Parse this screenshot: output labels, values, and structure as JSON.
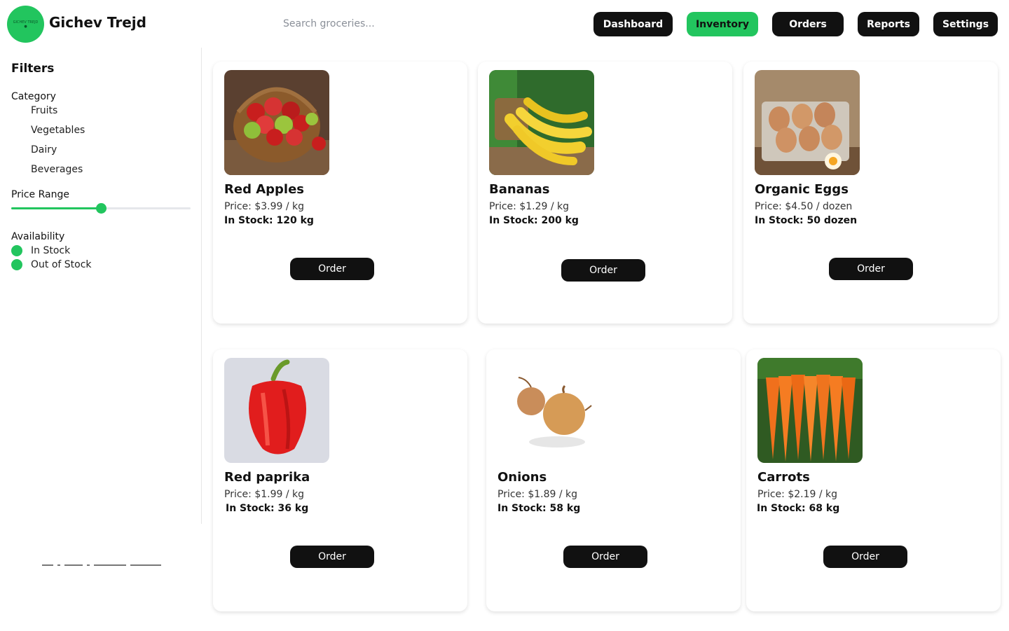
{
  "header": {
    "logo_text": "GICHEV TREJD",
    "brand": "Gichev Trejd",
    "search_placeholder": "Search groceries...",
    "nav": [
      {
        "label": "Dashboard",
        "active": false
      },
      {
        "label": "Inventory",
        "active": true
      },
      {
        "label": "Orders",
        "active": false
      },
      {
        "label": "Reports",
        "active": false
      },
      {
        "label": "Settings",
        "active": false
      }
    ]
  },
  "sidebar": {
    "title": "Filters",
    "category_title": "Category",
    "categories": [
      "Fruits",
      "Vegetables",
      "Dairy",
      "Beverages"
    ],
    "price_title": "Price Range",
    "price_level": 0.5,
    "availability_title": "Availability",
    "availability": [
      "In Stock",
      "Out of Stock"
    ]
  },
  "products": [
    {
      "name": "Red Apples",
      "price": "Price: $3.99 / kg",
      "stock": "In Stock: 120 kg",
      "order_label": "Order",
      "image": "apples-basket"
    },
    {
      "name": "Bananas",
      "price": "Price: $1.29 / kg",
      "stock": "In Stock: 200 kg",
      "order_label": "Order",
      "image": "bananas-bunch"
    },
    {
      "name": "Organic Eggs",
      "price": "Price: $4.50 / dozen",
      "stock": "In Stock: 50 dozen",
      "order_label": "Order",
      "image": "eggs-carton"
    },
    {
      "name": "Red paprika",
      "price": "Price: $1.99 / kg",
      "stock": "In Stock: 36 kg",
      "order_label": "Order",
      "image": "red-pepper"
    },
    {
      "name": "Onions",
      "price": "Price: $1.89 / kg",
      "stock": "In Stock: 58 kg",
      "order_label": "Order",
      "image": "onions"
    },
    {
      "name": "Carrots",
      "price": "Price: $2.19 / kg",
      "stock": "In Stock: 68 kg",
      "order_label": "Order",
      "image": "carrots-bunch"
    }
  ],
  "colors": {
    "accent": "#22c55e",
    "button": "#111111"
  }
}
